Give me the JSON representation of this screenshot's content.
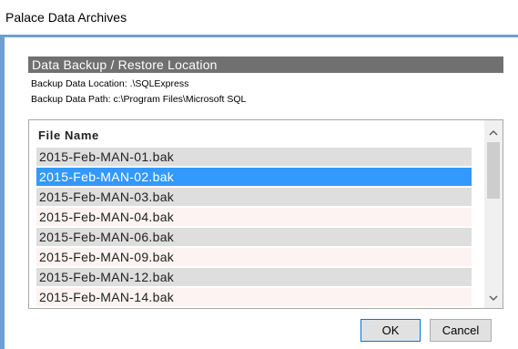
{
  "window": {
    "title": "Palace Data Archives"
  },
  "section": {
    "header": "Data Backup / Restore Location",
    "location_text": "Backup Data Location: .\\SQLExpress",
    "path_text": "Backup Data Path: c:\\Program Files\\Microsoft SQL"
  },
  "file_list": {
    "column_header": "File Name",
    "selected_index": 1,
    "items": [
      "2015-Feb-MAN-01.bak",
      "2015-Feb-MAN-02.bak",
      "2015-Feb-MAN-03.bak",
      "2015-Feb-MAN-04.bak",
      "2015-Feb-MAN-06.bak",
      "2015-Feb-MAN-09.bak",
      "2015-Feb-MAN-12.bak",
      "2015-Feb-MAN-14.bak"
    ],
    "scroll_up_icon": "chevron-up-icon",
    "scroll_down_icon": "chevron-down-icon"
  },
  "buttons": {
    "ok": "OK",
    "cancel": "Cancel"
  },
  "colors": {
    "frame_accent": "#6e9fd3",
    "header_bg": "#707070",
    "selection": "#3399ff",
    "row_alt": "#dedede",
    "row_plain": "#fdf3f2"
  }
}
